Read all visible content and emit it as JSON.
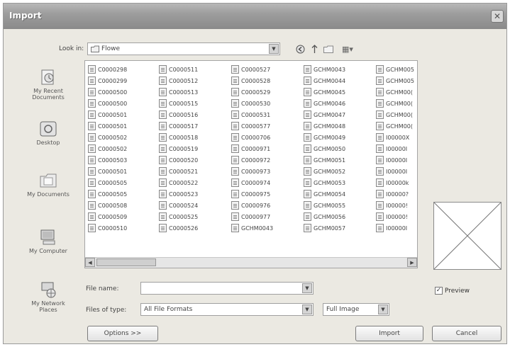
{
  "window": {
    "title": "Import",
    "close_glyph": "✕"
  },
  "lookin": {
    "label": "Look in:",
    "value": "Flowe"
  },
  "toolbar": {
    "icons": [
      "back-icon",
      "up-folder-icon",
      "new-folder-icon",
      "view-menu-icon"
    ],
    "view_glyph": "▦▾"
  },
  "places": [
    {
      "label": "My Recent Documents",
      "icon": "recent-documents-icon"
    },
    {
      "label": "Desktop",
      "icon": "desktop-icon"
    },
    {
      "label": "My Documents",
      "icon": "my-documents-icon"
    },
    {
      "label": "My Computer",
      "icon": "my-computer-icon"
    },
    {
      "label": "My Network Places",
      "icon": "network-places-icon"
    }
  ],
  "files": {
    "columns": [
      [
        "C0000298",
        "C0000299",
        "C0000500",
        "C0000500",
        "C0000501",
        "C0000501",
        "C0000502",
        "C0000502",
        "C0000503",
        "C0000501",
        "C0000505",
        "C0000505",
        "C0000508",
        "C0000509",
        "C0000510"
      ],
      [
        "C0000511",
        "C0000512",
        "C0000513",
        "C0000515",
        "C0000516",
        "C0000517",
        "C0000518",
        "C0000519",
        "C0000520",
        "C0000521",
        "C0000522",
        "C0000523",
        "C0000524",
        "C0000525",
        "C0000526"
      ],
      [
        "C0000527",
        "C0000528",
        "C0000529",
        "C0000530",
        "C0000531",
        "C0000577",
        "C0000706",
        "C0000971",
        "C0000972",
        "C0000973",
        "C0000974",
        "C0000975",
        "C0000976",
        "C0000977",
        "GCHM0043"
      ],
      [
        "GCHM0043",
        "GCHM0044",
        "GCHM0045",
        "GCHM0046",
        "GCHM0047",
        "GCHM0048",
        "GCHM0049",
        "GCHM0050",
        "GCHM0051",
        "GCHM0052",
        "GCHM0053",
        "GCHM0054",
        "GCHM0055",
        "GCHM0056",
        "GCHM0057"
      ],
      [
        "GCHM005",
        "GCHM005",
        "GCHM00(",
        "GCHM00(",
        "GCHM00(",
        "GCHM00(",
        "I00000X",
        "I00000I",
        "I00000I",
        "I00000I",
        "I00000k",
        "I00000?",
        "I00000!",
        "I00000!",
        "I00000I"
      ]
    ]
  },
  "filename": {
    "label": "File name:",
    "value": ""
  },
  "filetype": {
    "label": "Files of type:",
    "value": "All File Formats"
  },
  "size": {
    "value": "Full Image"
  },
  "preview": {
    "label": "Preview",
    "checked_glyph": "✓",
    "checked": true
  },
  "buttons": {
    "options": "Options >>",
    "import": "Import",
    "cancel": "Cancel"
  },
  "scroll": {
    "left_glyph": "◀",
    "right_glyph": "▶"
  },
  "combo_arrow": "▼"
}
